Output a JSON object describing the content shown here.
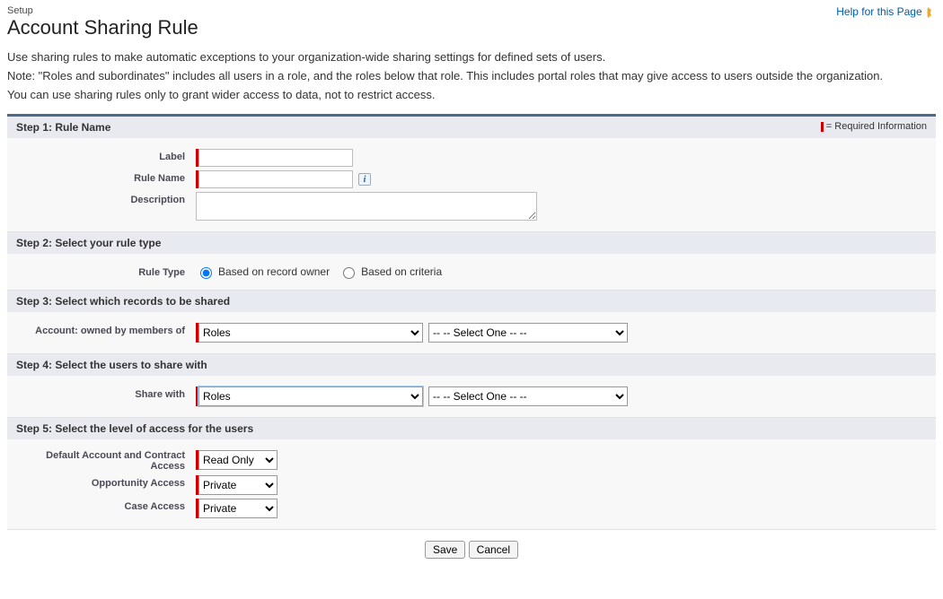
{
  "header": {
    "crumb": "Setup",
    "title": "Account Sharing Rule",
    "help_link": "Help for this Page"
  },
  "intro": {
    "p1": "Use sharing rules to make automatic exceptions to your organization-wide sharing settings for defined sets of users.",
    "p2": "Note: \"Roles and subordinates\" includes all users in a role, and the roles below that role. This includes portal roles that may give access to users outside the organization.",
    "p3": "You can use sharing rules only to grant wider access to data, not to restrict access."
  },
  "required_text": "= Required Information",
  "steps": {
    "s1": {
      "title": "Step 1: Rule Name",
      "label_lbl": "Label",
      "rulename_lbl": "Rule Name",
      "description_lbl": "Description",
      "label_val": "",
      "rulename_val": "",
      "description_val": ""
    },
    "s2": {
      "title": "Step 2: Select your rule type",
      "rule_type_lbl": "Rule Type",
      "opt_owner": "Based on record owner",
      "opt_criteria": "Based on criteria"
    },
    "s3": {
      "title": "Step 3: Select which records to be shared",
      "owned_lbl": "Account: owned by members of",
      "category_val": "Roles",
      "select_one": "-- -- Select One -- --"
    },
    "s4": {
      "title": "Step 4: Select the users to share with",
      "share_lbl": "Share with",
      "category_val": "Roles",
      "select_one": "-- -- Select One -- --"
    },
    "s5": {
      "title": "Step 5: Select the level of access for the users",
      "acct_lbl": "Default Account and Contract Access",
      "opp_lbl": "Opportunity Access",
      "case_lbl": "Case Access",
      "acct_val": "Read Only",
      "opp_val": "Private",
      "case_val": "Private"
    }
  },
  "buttons": {
    "save": "Save",
    "cancel": "Cancel"
  }
}
